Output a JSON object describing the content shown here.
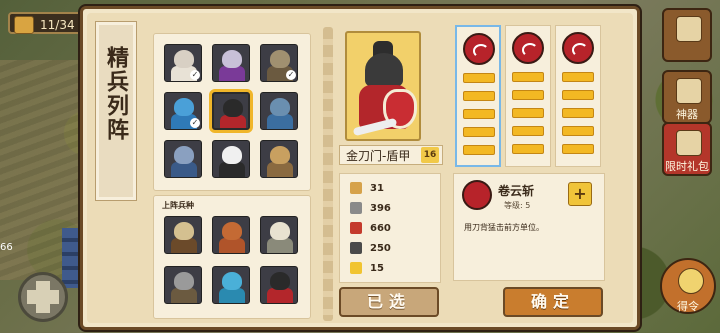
{
  "hud": {
    "counter": "11/34",
    "left_number": "66",
    "right_menu": [
      {
        "label": ""
      },
      {
        "label": "神器"
      },
      {
        "label": "限时礼包"
      },
      {
        "label": "得令"
      }
    ]
  },
  "panel": {
    "title": "精兵列阵",
    "roster": {
      "units": [
        {
          "name": "unit-1",
          "head": "#d8d0c4",
          "body": "#e8e2d6",
          "check": true
        },
        {
          "name": "unit-2",
          "head": "#c8c0d8",
          "body": "#7a3a98",
          "check": false
        },
        {
          "name": "unit-3",
          "head": "#a09070",
          "body": "#6b5a40",
          "check": true
        },
        {
          "name": "unit-4",
          "head": "#4aa0d8",
          "body": "#2f7ab8",
          "check": true
        },
        {
          "name": "unit-5",
          "head": "#2a2a2a",
          "body": "#b3262b",
          "check": false,
          "selected": true
        },
        {
          "name": "unit-6",
          "head": "#6a8fb0",
          "body": "#3b6ea0",
          "check": false
        },
        {
          "name": "unit-7",
          "head": "#8aa0c0",
          "body": "#3a5a88",
          "check": false
        },
        {
          "name": "unit-8",
          "head": "#f0f0f0",
          "body": "#2a2a2a",
          "check": false
        },
        {
          "name": "unit-9",
          "head": "#c8a060",
          "body": "#8a6a40",
          "check": false
        }
      ]
    },
    "deployed": {
      "label": "上阵兵种",
      "units": [
        {
          "name": "deploy-1",
          "head": "#d4c090",
          "body": "#6b4a2a"
        },
        {
          "name": "deploy-2",
          "head": "#c46a34",
          "body": "#b0542a"
        },
        {
          "name": "deploy-3",
          "head": "#e8e2d0",
          "body": "#8a8a7a"
        },
        {
          "name": "deploy-4",
          "head": "#9a9a9a",
          "body": "#6b5a40"
        },
        {
          "name": "deploy-5",
          "head": "#4ab0d8",
          "body": "#2a8ab0"
        },
        {
          "name": "deploy-6",
          "head": "#2a2a2a",
          "body": "#b3262b"
        }
      ]
    },
    "hero": {
      "name": "金刀门-盾甲",
      "level": "16"
    },
    "stats": [
      {
        "name": "attack",
        "value": "31",
        "color": "#d6a24a"
      },
      {
        "name": "defense",
        "value": "396",
        "color": "#8a8a8a"
      },
      {
        "name": "health",
        "value": "660",
        "color": "#c43a2c"
      },
      {
        "name": "armor",
        "value": "250",
        "color": "#4a4a4a"
      },
      {
        "name": "speed",
        "value": "15",
        "color": "#f1c430"
      }
    ],
    "skill": {
      "name": "卷云斩",
      "level": "等级: 5",
      "description": "用刀背猛击前方单位。",
      "plus": "+"
    },
    "buttons": {
      "selected": "已选",
      "confirm": "确定"
    }
  }
}
